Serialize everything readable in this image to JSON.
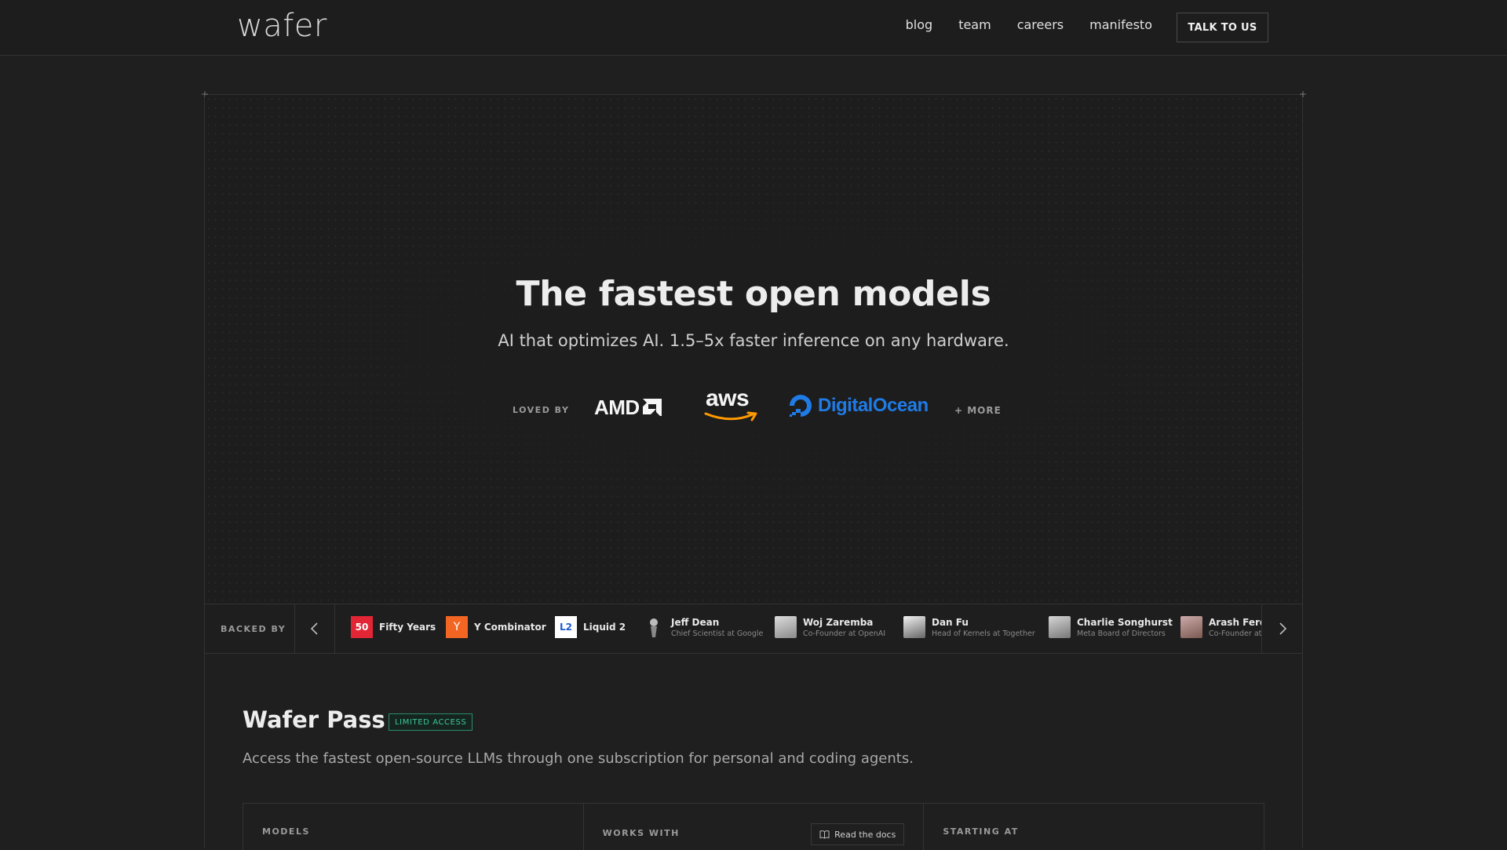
{
  "nav": {
    "logo": "wafer",
    "links": [
      "blog",
      "team",
      "careers",
      "manifesto"
    ],
    "cta": "TALK TO US"
  },
  "hero": {
    "title": "The fastest open models",
    "subtitle": "AI that optimizes AI. 1.5–5x faster inference on any hardware.",
    "loved_by_label": "LOVED BY",
    "logos": [
      "AMD",
      "aws",
      "DigitalOcean"
    ],
    "more": "+ MORE"
  },
  "backed": {
    "label": "BACKED BY",
    "investors": [
      {
        "name": "Fifty Years",
        "title": "",
        "icon": "fifty-years-logo"
      },
      {
        "name": "Y Combinator",
        "title": "",
        "icon": "y-combinator-logo"
      },
      {
        "name": "Liquid 2",
        "title": "",
        "icon": "liquid-2-logo"
      },
      {
        "name": "Jeff Dean",
        "title": "Chief Scientist at Google",
        "icon": "jeff-dean-avatar"
      },
      {
        "name": "Woj Zaremba",
        "title": "Co-Founder at OpenAI",
        "icon": "woj-zaremba-avatar"
      },
      {
        "name": "Dan Fu",
        "title": "Head of Kernels at Together",
        "icon": "dan-fu-avatar"
      },
      {
        "name": "Charlie Songhurst",
        "title": "Meta Board of Directors",
        "icon": "charlie-songhurst-avatar"
      },
      {
        "name": "Arash Ferdo",
        "title": "Co-Founder at",
        "icon": "arash-avatar"
      }
    ]
  },
  "pass": {
    "title": "Wafer Pass",
    "badge": "LIMITED ACCESS",
    "description": "Access the fastest open-source LLMs through one subscription for personal and coding agents.",
    "columns": [
      "MODELS",
      "WORKS WITH",
      "STARTING AT"
    ],
    "docs_button": "Read the docs"
  },
  "colors": {
    "background": "#1f1f1f",
    "digitalocean": "#1f7be6",
    "badge": "#3cc89a",
    "ycombinator": "#f26522",
    "fifty_years": "#e32636"
  }
}
